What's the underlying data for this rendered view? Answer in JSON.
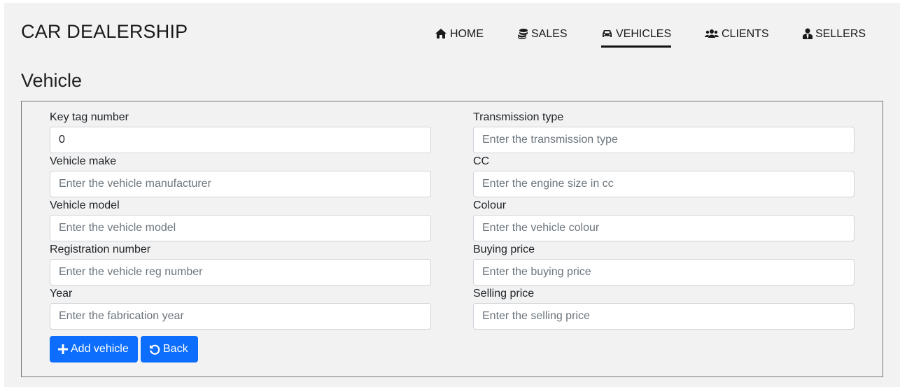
{
  "brand": "CAR DEALERSHIP",
  "nav": {
    "items": [
      {
        "label": "HOME",
        "icon": "home-icon"
      },
      {
        "label": "SALES",
        "icon": "coins-icon"
      },
      {
        "label": "VEHICLES",
        "icon": "car-icon",
        "active": true
      },
      {
        "label": "CLIENTS",
        "icon": "users-icon"
      },
      {
        "label": "SELLERS",
        "icon": "user-tie-icon"
      }
    ]
  },
  "page_title": "Vehicle",
  "form": {
    "left": [
      {
        "label": "Key tag number",
        "value": "0",
        "placeholder": ""
      },
      {
        "label": "Vehicle make",
        "value": "",
        "placeholder": "Enter the vehicle manufacturer"
      },
      {
        "label": "Vehicle model",
        "value": "",
        "placeholder": "Enter the vehicle model"
      },
      {
        "label": "Registration number",
        "value": "",
        "placeholder": "Enter the vehicle reg number"
      },
      {
        "label": "Year",
        "value": "",
        "placeholder": "Enter the fabrication year"
      }
    ],
    "right": [
      {
        "label": "Transmission type",
        "value": "",
        "placeholder": "Enter the transmission type"
      },
      {
        "label": "CC",
        "value": "",
        "placeholder": "Enter the engine size in cc"
      },
      {
        "label": "Colour",
        "value": "",
        "placeholder": "Enter the vehicle colour"
      },
      {
        "label": "Buying price",
        "value": "",
        "placeholder": "Enter the buying price"
      },
      {
        "label": "Selling price",
        "value": "",
        "placeholder": "Enter the selling price"
      }
    ]
  },
  "buttons": {
    "add_label": "Add vehicle",
    "back_label": "Back"
  },
  "colors": {
    "primary": "#0d6efd",
    "background": "#f2f2f2"
  }
}
